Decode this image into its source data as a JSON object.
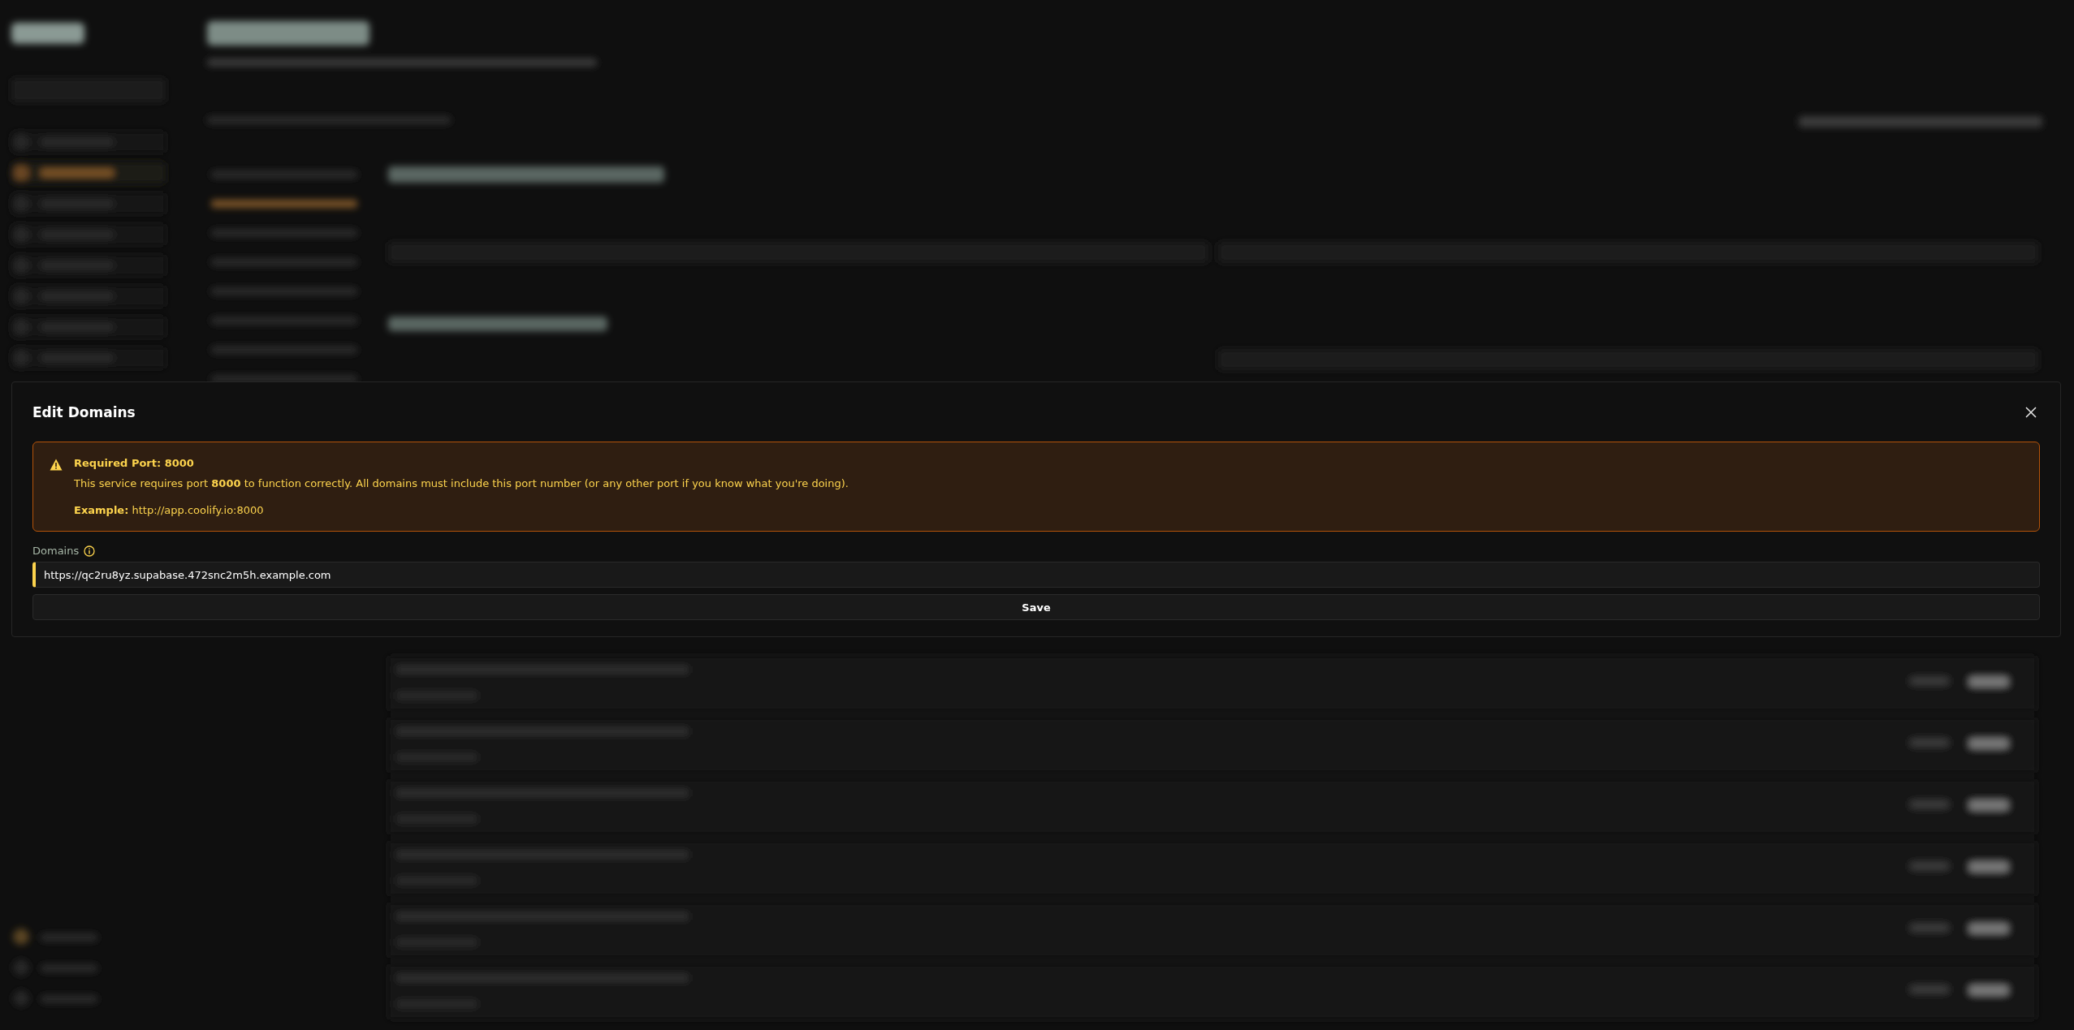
{
  "modal": {
    "title": "Edit Domains",
    "alert": {
      "title": "Required Port: 8000",
      "body": "This service requires port **8000** to function correctly. All domains must include this port number (or any other port if you know what you're doing).",
      "example": "**Example:** http://app.coolify.io:8000"
    },
    "field": {
      "label": "Domains",
      "value": "https://qc2ru8yz.supabase.472snc2m5h.example.com",
      "focused": true
    },
    "save_button": "Save"
  }
}
